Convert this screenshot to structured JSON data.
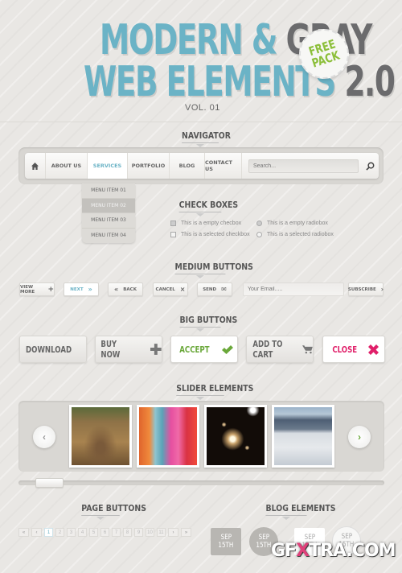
{
  "header": {
    "title_line1_blue": "MODERN &",
    "title_line1_gray": "GRAY",
    "title_line2_blue": "WEB ELEMENTS",
    "title_line2_gray": "2.0",
    "volume": "VOL. 01",
    "badge_line1": "FREE",
    "badge_line2": "PACK"
  },
  "colors": {
    "accent_blue": "#6bb3c6",
    "accent_green": "#8cbf3a",
    "accent_pink": "#e0206a",
    "title_gray": "#6b6b6d",
    "background": "#e9e7e4"
  },
  "navigator": {
    "heading": "NAVIGATOR",
    "home_icon": "home-icon",
    "items": [
      {
        "label": "ABOUT US"
      },
      {
        "label": "SERVICES",
        "active": true
      },
      {
        "label": "PORTFOLIO"
      },
      {
        "label": "BLOG"
      },
      {
        "label": "CONTACT US"
      }
    ],
    "search_placeholder": "Search...",
    "search_icon": "magnifier-icon",
    "dropdown": [
      {
        "label": "MENU ITEM 01"
      },
      {
        "label": "MENU ITEM 02",
        "active": true
      },
      {
        "label": "MENU ITEM 03"
      },
      {
        "label": "MENU ITEM 04"
      }
    ]
  },
  "checkboxes": {
    "heading": "CHECK BOXES",
    "checkbox_empty": "This is a empty checbox",
    "checkbox_selected": "This is a selected checkbox",
    "radio_empty": "This is a empty radiobox",
    "radio_selected": "This is a selected radiobox"
  },
  "medium_buttons": {
    "heading": "MEDIUM BUTTONS",
    "view_more": "VIEW MORE",
    "next": "NEXT",
    "back": "BACK",
    "cancel": "CANCEL",
    "send": "SEND",
    "email_placeholder": "Your Email.....",
    "subscribe": "SUBSCRIBE",
    "icons": {
      "view_more": "+",
      "next": "»",
      "back": "«",
      "cancel": "×",
      "send": "✉",
      "subscribe": "›"
    }
  },
  "big_buttons": {
    "heading": "BIG BUTTONS",
    "download": "DOWNLOAD",
    "buy_now": "BUY NOW",
    "accept": "ACCEPT",
    "add_to_cart": "ADD TO CART",
    "close": "CLOSE"
  },
  "slider": {
    "heading": "SLIDER ELEMENTS",
    "slides": [
      {
        "name": "motocross-photo"
      },
      {
        "name": "colorful-braids-photo"
      },
      {
        "name": "galaxy-cluster-photo"
      },
      {
        "name": "arctic-landscape-photo"
      }
    ],
    "prev_icon": "‹",
    "next_icon": "›",
    "scroll_position": 0.05
  },
  "pagination": {
    "heading": "PAGE BUTTONS",
    "first": "«",
    "prev": "‹",
    "pages": [
      "1",
      "2",
      "3",
      "4",
      "5",
      "6",
      "7",
      "8",
      "9",
      "10",
      "11"
    ],
    "current": "1",
    "next": "›",
    "last": "»"
  },
  "blog": {
    "heading": "BLOG ELEMENTS",
    "dates": [
      {
        "month": "SEP",
        "day": "15TH"
      },
      {
        "month": "SEP",
        "day": "15TH"
      },
      {
        "month": "SEP",
        "day": "15TH"
      },
      {
        "month": "SEP",
        "day": "15TH"
      }
    ]
  },
  "watermark": {
    "pre": "GF",
    "x": "X",
    "post": "TRA.COM"
  }
}
